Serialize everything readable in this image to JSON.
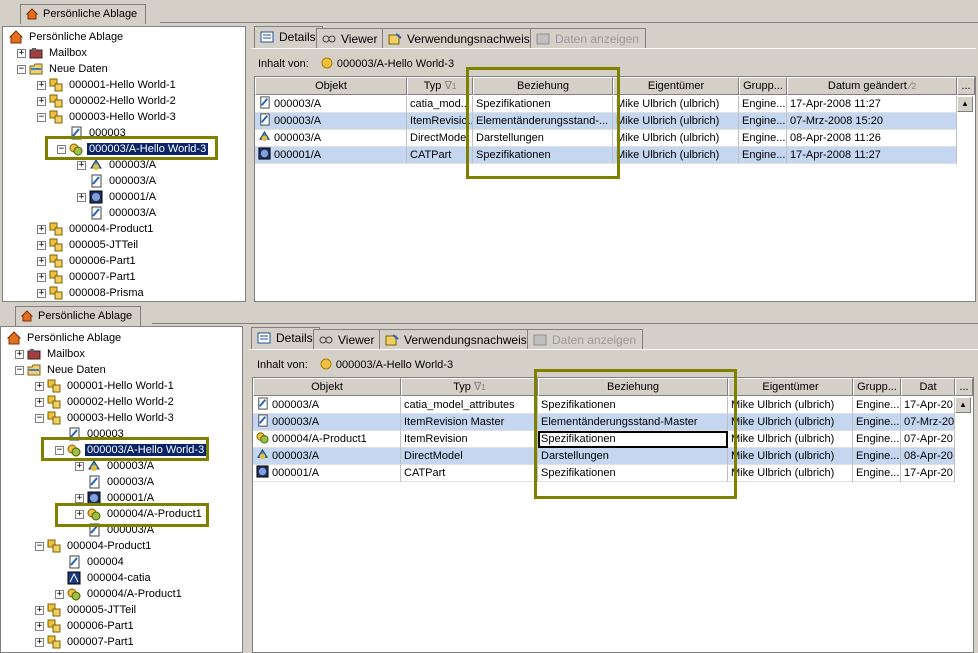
{
  "panel1": {
    "main_tab": "Persönliche Ablage",
    "tree": [
      {
        "label": "Persönliche Ablage",
        "indent": 0,
        "icon": "home-icon"
      },
      {
        "label": "Mailbox",
        "indent": 1,
        "icon": "mailbox-icon"
      },
      {
        "label": "Neue Daten",
        "indent": 1,
        "icon": "folder-icon"
      },
      {
        "label": "000001-Hello World-1",
        "indent": 2,
        "icon": "item-icon"
      },
      {
        "label": "000002-Hello World-2",
        "indent": 2,
        "icon": "item-icon"
      },
      {
        "label": "000003-Hello World-3",
        "indent": 2,
        "icon": "item-icon"
      },
      {
        "label": "000003",
        "indent": 3,
        "icon": "document-icon"
      },
      {
        "label": "000003/A-Hello World-3",
        "indent": 3,
        "icon": "revision-icon",
        "selected": true
      },
      {
        "label": "000003/A",
        "indent": 4,
        "icon": "direct-model-icon"
      },
      {
        "label": "000003/A",
        "indent": 4,
        "icon": "document-icon"
      },
      {
        "label": "000001/A",
        "indent": 4,
        "icon": "catpart-icon"
      },
      {
        "label": "000003/A",
        "indent": 4,
        "icon": "document-icon"
      },
      {
        "label": "000004-Product1",
        "indent": 2,
        "icon": "item-icon"
      },
      {
        "label": "000005-JTTeil",
        "indent": 2,
        "icon": "item-icon"
      },
      {
        "label": "000006-Part1",
        "indent": 2,
        "icon": "item-icon"
      },
      {
        "label": "000007-Part1",
        "indent": 2,
        "icon": "item-icon"
      },
      {
        "label": "000008-Prisma",
        "indent": 2,
        "icon": "item-icon"
      }
    ],
    "tabs": [
      "Details",
      "Viewer",
      "Verwendungsnachweis",
      "Daten anzeigen"
    ],
    "inhalt_label": "Inhalt von:",
    "inhalt_value": "000003/A-Hello World-3",
    "columns": [
      "Objekt",
      "Typ",
      "Beziehung",
      "Eigentümer",
      "Grupp...",
      "Datum geändert",
      "..."
    ],
    "typ_sort": "1",
    "datum_sort": "2",
    "rows": [
      {
        "objekt": "000003/A",
        "typ": "catia_mod...",
        "beziehung": "Spezifikationen",
        "eigentuemer": "Mike Ulbrich (ulbrich)",
        "gruppe": "Engine...",
        "datum": "17-Apr-2008 11:27"
      },
      {
        "objekt": "000003/A",
        "typ": "ItemRevisio...",
        "beziehung": "Elementänderungsstand-...",
        "eigentuemer": "Mike Ulbrich (ulbrich)",
        "gruppe": "Engine...",
        "datum": "07-Mrz-2008 15:20"
      },
      {
        "objekt": "000003/A",
        "typ": "DirectModel",
        "beziehung": "Darstellungen",
        "eigentuemer": "Mike Ulbrich (ulbrich)",
        "gruppe": "Engine...",
        "datum": "08-Apr-2008 11:26"
      },
      {
        "objekt": "000001/A",
        "typ": "CATPart",
        "beziehung": "Spezifikationen",
        "eigentuemer": "Mike Ulbrich (ulbrich)",
        "gruppe": "Engine...",
        "datum": "17-Apr-2008 11:27"
      }
    ]
  },
  "panel2": {
    "main_tab": "Persönliche Ablage",
    "tree": [
      {
        "label": "Persönliche Ablage",
        "indent": 0,
        "icon": "home-icon"
      },
      {
        "label": "Mailbox",
        "indent": 1,
        "icon": "mailbox-icon"
      },
      {
        "label": "Neue Daten",
        "indent": 1,
        "icon": "folder-icon"
      },
      {
        "label": "000001-Hello World-1",
        "indent": 2,
        "icon": "item-icon"
      },
      {
        "label": "000002-Hello World-2",
        "indent": 2,
        "icon": "item-icon"
      },
      {
        "label": "000003-Hello World-3",
        "indent": 2,
        "icon": "item-icon"
      },
      {
        "label": "000003",
        "indent": 3,
        "icon": "document-icon"
      },
      {
        "label": "000003/A-Hello World-3",
        "indent": 3,
        "icon": "revision-icon",
        "selected": true
      },
      {
        "label": "000003/A",
        "indent": 4,
        "icon": "direct-model-icon"
      },
      {
        "label": "000003/A",
        "indent": 4,
        "icon": "document-icon"
      },
      {
        "label": "000001/A",
        "indent": 4,
        "icon": "catpart-icon"
      },
      {
        "label": "000004/A-Product1",
        "indent": 4,
        "icon": "revision-icon"
      },
      {
        "label": "000003/A",
        "indent": 4,
        "icon": "document-icon"
      },
      {
        "label": "000004-Product1",
        "indent": 2,
        "icon": "item-icon"
      },
      {
        "label": "000004",
        "indent": 3,
        "icon": "document-icon"
      },
      {
        "label": "000004-catia",
        "indent": 3,
        "icon": "catia-icon"
      },
      {
        "label": "000004/A-Product1",
        "indent": 3,
        "icon": "revision-icon"
      },
      {
        "label": "000005-JTTeil",
        "indent": 2,
        "icon": "item-icon"
      },
      {
        "label": "000006-Part1",
        "indent": 2,
        "icon": "item-icon"
      },
      {
        "label": "000007-Part1",
        "indent": 2,
        "icon": "item-icon"
      }
    ],
    "tabs": [
      "Details",
      "Viewer",
      "Verwendungsnachweis",
      "Daten anzeigen"
    ],
    "inhalt_label": "Inhalt von:",
    "inhalt_value": "000003/A-Hello World-3",
    "columns": [
      "Objekt",
      "Typ",
      "Beziehung",
      "Eigentümer",
      "Grupp...",
      "Dat",
      "..."
    ],
    "typ_sort": "1",
    "rows": [
      {
        "objekt": "000003/A",
        "typ": "catia_model_attributes",
        "beziehung": "Spezifikationen",
        "eigentuemer": "Mike Ulbrich (ulbrich)",
        "gruppe": "Engine...",
        "datum": "17-Apr-20"
      },
      {
        "objekt": "000003/A",
        "typ": "ItemRevision Master",
        "beziehung": "Elementänderungsstand-Master",
        "eigentuemer": "Mike Ulbrich (ulbrich)",
        "gruppe": "Engine...",
        "datum": "07-Mrz-20"
      },
      {
        "objekt": "000004/A-Product1",
        "typ": "ItemRevision",
        "beziehung": "Spezifikationen",
        "eigentuemer": "Mike Ulbrich (ulbrich)",
        "gruppe": "Engine...",
        "datum": "07-Apr-20"
      },
      {
        "objekt": "000003/A",
        "typ": "DirectModel",
        "beziehung": "Darstellungen",
        "eigentuemer": "Mike Ulbrich (ulbrich)",
        "gruppe": "Engine...",
        "datum": "08-Apr-20"
      },
      {
        "objekt": "000001/A",
        "typ": "CATPart",
        "beziehung": "Spezifikationen",
        "eigentuemer": "Mike Ulbrich (ulbrich)",
        "gruppe": "Engine...",
        "datum": "17-Apr-20"
      }
    ]
  },
  "colors": {
    "highlight_box": "#808000",
    "selection_bg": "#0a246a",
    "alt_row": "#c5d7f0"
  }
}
